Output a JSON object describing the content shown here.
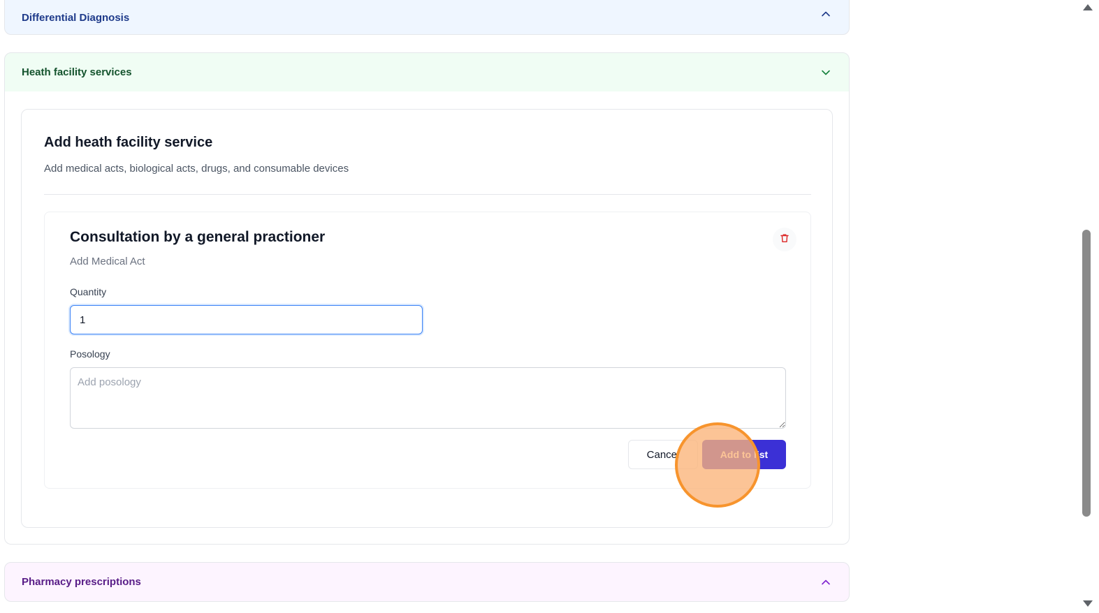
{
  "sections": {
    "differential_diagnosis": {
      "title": "Differential Diagnosis",
      "color": "#1e3a8a",
      "icon": "chevron-up-icon"
    },
    "health_facility_services": {
      "title": "Heath facility services",
      "color": "#14532d",
      "icon": "chevron-down-icon"
    },
    "pharmacy_prescriptions": {
      "title": "Pharmacy prescriptions",
      "color": "#581c87",
      "icon": "chevron-up-icon"
    }
  },
  "add_service_card": {
    "title": "Add heath facility service",
    "description": "Add medical acts, biological acts, drugs, and consumable devices"
  },
  "service_item": {
    "title": "Consultation by a general practioner",
    "subtitle": "Add Medical Act",
    "delete_icon": "trash-icon",
    "quantity": {
      "label": "Quantity",
      "value": "1"
    },
    "posology": {
      "label": "Posology",
      "placeholder": "Add posology",
      "value": ""
    },
    "cancel_label": "Cancel",
    "add_label": "Add to list"
  },
  "colors": {
    "primary_button": "#3b30d6",
    "delete_icon": "#dc2626",
    "click_indicator": "#f7942d"
  }
}
